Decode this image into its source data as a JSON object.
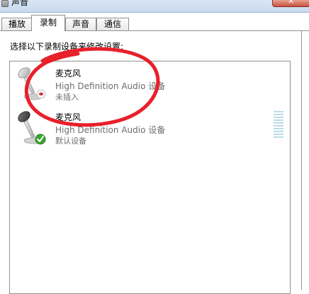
{
  "window": {
    "title": "声音",
    "close_glyph": "✕"
  },
  "tabs": [
    {
      "label": "播放",
      "active": false
    },
    {
      "label": "录制",
      "active": true
    },
    {
      "label": "声音",
      "active": false
    },
    {
      "label": "通信",
      "active": false
    }
  ],
  "panel": {
    "instruction": "选择以下录制设备来修改设置:"
  },
  "devices": [
    {
      "name": "麦克风",
      "description": "High Definition Audio 设备",
      "status": "未插入",
      "state_icon": "unplugged-red-icon"
    },
    {
      "name": "麦克风",
      "description": "High Definition Audio 设备",
      "status": "默认设备",
      "state_icon": "default-check-icon"
    }
  ],
  "colors": {
    "annotation": "#e8202a",
    "check_green": "#3aa52f",
    "unplugged_red": "#d0302a",
    "meter": "#b9dde3"
  }
}
